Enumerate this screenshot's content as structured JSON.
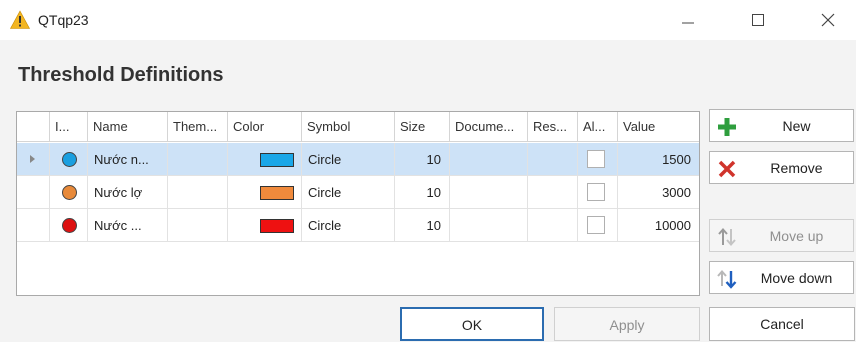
{
  "window": {
    "title": "QTqp23",
    "icon": "warning-icon"
  },
  "page": {
    "heading": "Threshold Definitions"
  },
  "grid": {
    "columns": [
      "I...",
      "Name",
      "Them...",
      "Color",
      "Symbol",
      "Size",
      "Docume...",
      "Res...",
      "Al...",
      "Value"
    ],
    "rows": [
      {
        "dot_color": "#1a9fe0",
        "name": "Nước n...",
        "theme": "",
        "color": "#1aa7e8",
        "symbol": "Circle",
        "size": "10",
        "document": "",
        "res": "",
        "al": false,
        "value": "1500",
        "selected": true
      },
      {
        "dot_color": "#e88a3a",
        "name": "Nước lợ",
        "theme": "",
        "color": "#f08a3c",
        "symbol": "Circle",
        "size": "10",
        "document": "",
        "res": "",
        "al": false,
        "value": "3000",
        "selected": false
      },
      {
        "dot_color": "#dd1111",
        "name": "Nước ...",
        "theme": "",
        "color": "#ee1111",
        "symbol": "Circle",
        "size": "10",
        "document": "",
        "res": "",
        "al": false,
        "value": "10000",
        "selected": false
      }
    ]
  },
  "buttons": {
    "new": "New",
    "remove": "Remove",
    "move_up": "Move up",
    "move_down": "Move down",
    "ok": "OK",
    "apply": "Apply",
    "cancel": "Cancel"
  },
  "colors": {
    "accent": "#2b6cb0",
    "selected_row": "#cde2f7",
    "new_icon": "#2e9e3e",
    "remove_icon": "#d0342c"
  }
}
